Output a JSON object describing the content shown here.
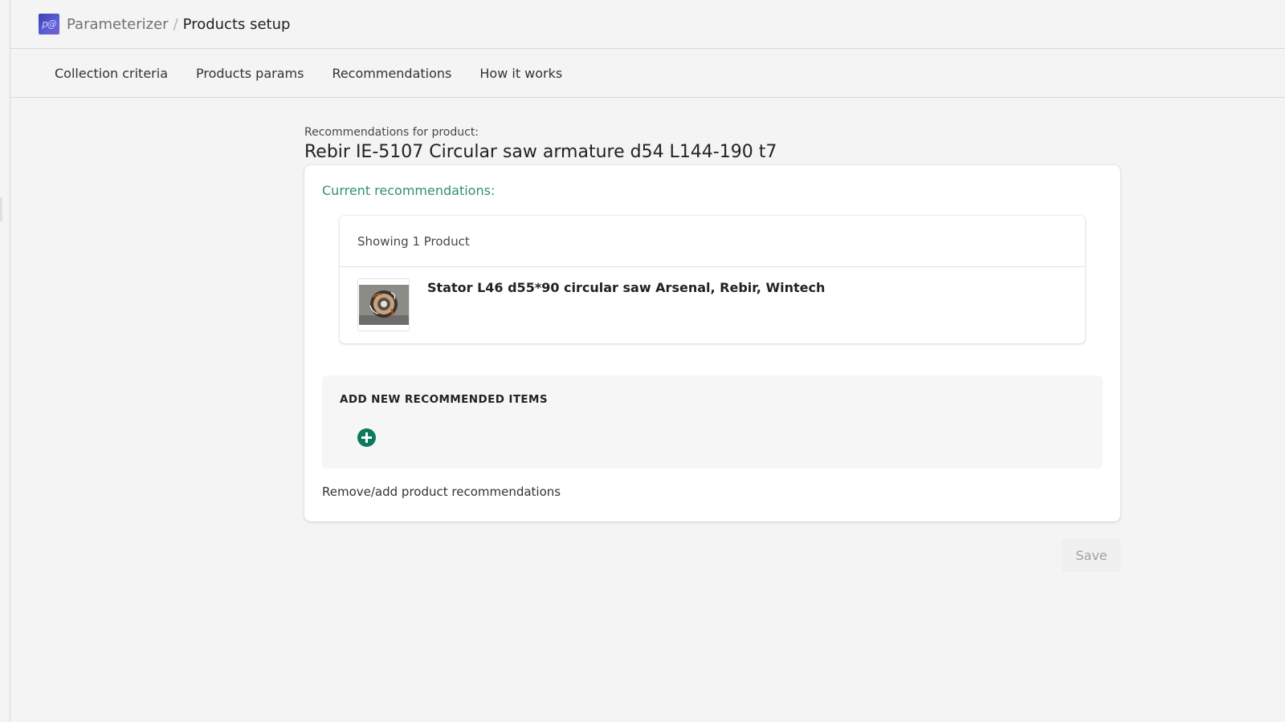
{
  "header": {
    "logo_text": "p@",
    "breadcrumb_root": "Parameterizer",
    "breadcrumb_separator": "/",
    "breadcrumb_current": "Products setup"
  },
  "tabs": [
    {
      "label": "Collection criteria"
    },
    {
      "label": "Products params"
    },
    {
      "label": "Recommendations"
    },
    {
      "label": "How it works"
    }
  ],
  "main": {
    "subtitle": "Recommendations for product:",
    "title": "Rebir IE-5107 Circular saw armature d54 L144-190 t7",
    "current_label": "Current recommendations:",
    "list": {
      "header": "Showing 1 Product",
      "items": [
        {
          "title": "Stator L46 d55*90 circular saw Arsenal, Rebir, Wintech",
          "thumbnail_icon": "stator-product-image"
        }
      ]
    },
    "add_panel": {
      "heading": "ADD NEW RECOMMENDED ITEMS",
      "add_icon": "plus-circle-icon"
    },
    "footnote": "Remove/add product recommendations",
    "save_label": "Save"
  },
  "colors": {
    "accent_green": "#0d7a5f",
    "label_teal": "#2f8f7a",
    "background": "#f4f4f4"
  }
}
